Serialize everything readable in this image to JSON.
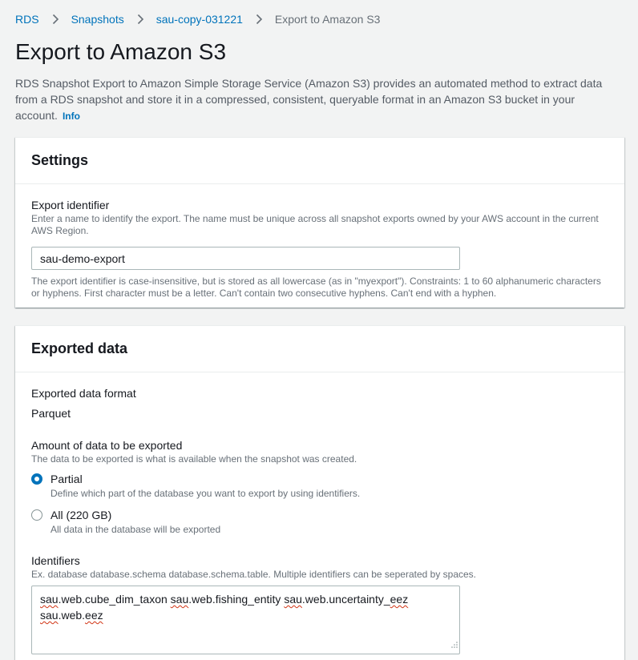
{
  "breadcrumb": {
    "items": [
      "RDS",
      "Snapshots",
      "sau-copy-031221"
    ],
    "current": "Export to Amazon S3"
  },
  "page": {
    "title": "Export to Amazon S3",
    "description": "RDS Snapshot Export to Amazon Simple Storage Service (Amazon S3) provides an automated method to extract data from a RDS snapshot and store it in a compressed, consistent, queryable format in an Amazon S3 bucket in your account.",
    "info_label": "Info"
  },
  "settings": {
    "heading": "Settings",
    "export_identifier": {
      "label": "Export identifier",
      "description": "Enter a name to identify the export. The name must be unique across all snapshot exports owned by your AWS account in the current AWS Region.",
      "value": "sau-demo-export",
      "constraint": "The export identifier is case-insensitive, but is stored as all lowercase (as in \"myexport\"). Constraints: 1 to 60 alphanumeric characters or hyphens. First character must be a letter. Can't contain two consecutive hyphens. Can't end with a hyphen."
    }
  },
  "exported_data": {
    "heading": "Exported data",
    "format_label": "Exported data format",
    "format_value": "Parquet",
    "amount_label": "Amount of data to be exported",
    "amount_description": "The data to be exported is what is available when the snapshot was created.",
    "options": [
      {
        "label": "Partial",
        "description": "Define which part of the database you want to export by using identifiers.",
        "selected": true
      },
      {
        "label": "All (220 GB)",
        "description": "All data in the database will be exported",
        "selected": false
      }
    ],
    "identifiers": {
      "label": "Identifiers",
      "description": "Ex. database database.schema database.schema.table. Multiple identifiers can be seperated by spaces.",
      "value_line1_parts": [
        "sau",
        ".web.cube_dim_taxon ",
        "sau",
        ".web.fishing_entity ",
        "sau",
        ".web.uncertainty_",
        "eez"
      ],
      "value_line2_parts": [
        "sau",
        ".web.",
        "eez"
      ]
    }
  },
  "colors": {
    "link": "#0073bb",
    "radio_selected": "#0073bb",
    "spellcheck": "#d13212",
    "page_bg": "#f2f3f3"
  }
}
